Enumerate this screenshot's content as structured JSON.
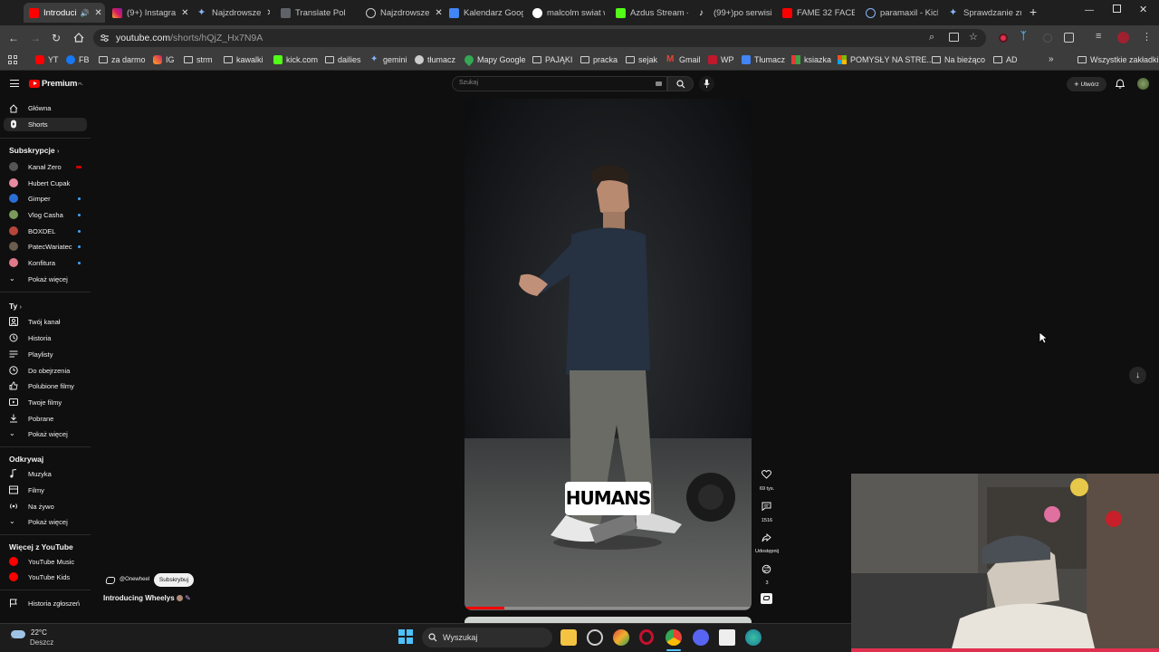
{
  "tabs": [
    {
      "label": "Introduci",
      "active": true
    },
    {
      "label": "(9+) Instagra"
    },
    {
      "label": "Najzdrowsze"
    },
    {
      "label": "Translate Pol"
    },
    {
      "label": "Najzdrowsze"
    },
    {
      "label": "Kalendarz Googl"
    },
    {
      "label": "malcolm swiat w"
    },
    {
      "label": "Azdus Stream - V"
    },
    {
      "label": "(99+)po serwisie"
    },
    {
      "label": "FAME 32 FACE2F"
    },
    {
      "label": "paramaxil - Kick"
    },
    {
      "label": "Sprawdzanie zua"
    }
  ],
  "address": {
    "domain": "youtube.com",
    "path": "/shorts/hQjZ_Hx7N9A"
  },
  "bookmarks": [
    "YT",
    "FB",
    "za darmo",
    "IG",
    "strm",
    "kawalki",
    "kick.com",
    "dailies",
    "gemini",
    "tłumacz",
    "Mapy Google",
    "PAJĄKI",
    "pracka",
    "sejak",
    "Gmail",
    "WP",
    "Tłumacz",
    "ksiazka",
    "POMYSŁY NA STRE...",
    "Na bieżąco",
    "AD",
    "Wszystkie zakładki"
  ],
  "header": {
    "logo": "Premium",
    "logo_sup": "PL",
    "search_placeholder": "Szukaj",
    "create_label": "Utwórz"
  },
  "sidebar": {
    "main": [
      {
        "label": "Główna",
        "icon": "home-icon"
      },
      {
        "label": "Shorts",
        "icon": "shorts-icon"
      }
    ],
    "subs_heading": "Subskrypcje",
    "subs": [
      {
        "label": "Kanał Zero",
        "color": "#555555"
      },
      {
        "label": "Hubert Cupak",
        "color": "#e88aa0"
      },
      {
        "label": "Gimper",
        "color": "#2b6fd6"
      },
      {
        "label": "Vlog Casha",
        "color": "#7a9a5a"
      },
      {
        "label": "BOXDEL",
        "color": "#b8453a"
      },
      {
        "label": "PatecWariatec",
        "color": "#6a5c4e"
      },
      {
        "label": "Konfitura",
        "color": "#e07a8a"
      },
      {
        "label": "Pokaż więcej",
        "color": ""
      }
    ],
    "you_heading": "Ty",
    "you": [
      "Twój kanał",
      "Historia",
      "Playlisty",
      "Do obejrzenia",
      "Polubione filmy",
      "Twoje filmy",
      "Pobrane",
      "Pokaż więcej"
    ],
    "explore_heading": "Odkrywaj",
    "explore": [
      "Muzyka",
      "Filmy",
      "Na żywo",
      "Pokaż więcej"
    ],
    "more_heading": "Więcej z YouTube",
    "more": [
      "YouTube Music",
      "YouTube Kids"
    ],
    "report": "Historia zgłoszeń"
  },
  "video": {
    "caption": "HUMANS",
    "channel": "@Onewheel",
    "subscribe": "Subskrybuj",
    "title": "Introducing Wheelys",
    "likes": "69 tys.",
    "comments": "1516",
    "share": "Udostępnij",
    "remix": "3",
    "progress": 0.14
  },
  "taskbar": {
    "weather_temp": "22°C",
    "weather_desc": "Deszcz",
    "search": "Wyszukaj"
  },
  "colors": {
    "yt_red": "#ff0000",
    "link_blue": "#3ea6ff",
    "page_bg": "#0f0f0f"
  }
}
